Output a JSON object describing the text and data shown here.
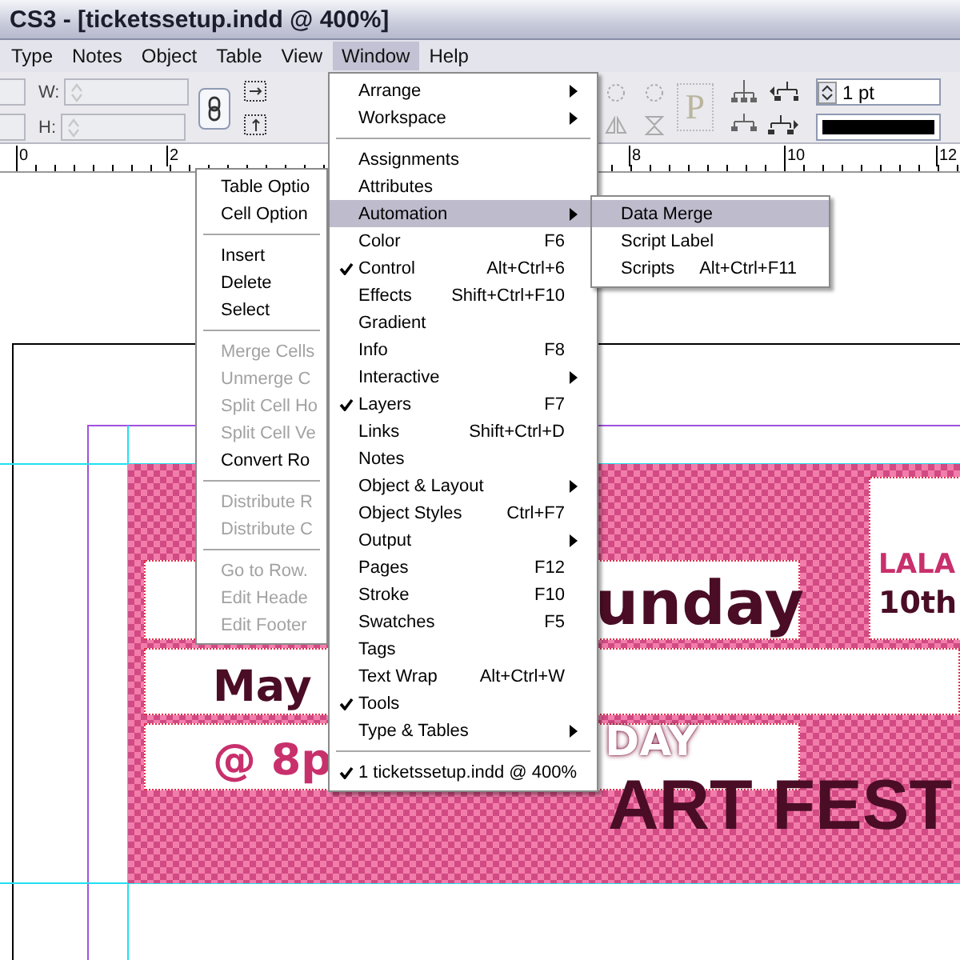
{
  "window": {
    "title": "CS3 - [ticketssetup.indd @ 400%]"
  },
  "menu_bar": [
    {
      "label": "Type",
      "selected": false
    },
    {
      "label": "Notes",
      "selected": false
    },
    {
      "label": "Object",
      "selected": false
    },
    {
      "label": "Table",
      "selected": false
    },
    {
      "label": "View",
      "selected": false
    },
    {
      "label": "Window",
      "selected": true
    },
    {
      "label": "Help",
      "selected": false
    }
  ],
  "control_panel": {
    "w_label": "W:",
    "h_label": "H:",
    "p_glyph": "P",
    "stroke_weight": "1 pt"
  },
  "ruler": {
    "labels": [
      "0",
      "2",
      "8",
      "10",
      "12"
    ]
  },
  "table_menu": {
    "items": [
      {
        "kind": "item",
        "label": "Table Optio",
        "disabled": false
      },
      {
        "kind": "item",
        "label": "Cell Option",
        "disabled": false
      },
      {
        "kind": "separator"
      },
      {
        "kind": "item",
        "label": "Insert",
        "disabled": false
      },
      {
        "kind": "item",
        "label": "Delete",
        "disabled": false
      },
      {
        "kind": "item",
        "label": "Select",
        "disabled": false
      },
      {
        "kind": "separator"
      },
      {
        "kind": "item",
        "label": "Merge Cells",
        "disabled": true
      },
      {
        "kind": "item",
        "label": "Unmerge C",
        "disabled": true
      },
      {
        "kind": "item",
        "label": "Split Cell Ho",
        "disabled": true
      },
      {
        "kind": "item",
        "label": "Split Cell Ve",
        "disabled": true
      },
      {
        "kind": "item",
        "label": "Convert Ro",
        "disabled": false
      },
      {
        "kind": "separator"
      },
      {
        "kind": "item",
        "label": "Distribute R",
        "disabled": true
      },
      {
        "kind": "item",
        "label": "Distribute C",
        "disabled": true
      },
      {
        "kind": "separator"
      },
      {
        "kind": "item",
        "label": "Go to Row.",
        "disabled": true
      },
      {
        "kind": "item",
        "label": "Edit Heade",
        "disabled": true
      },
      {
        "kind": "item",
        "label": "Edit Footer",
        "disabled": true
      }
    ]
  },
  "window_menu": {
    "items": [
      {
        "kind": "item",
        "label": "Arrange",
        "checked": false,
        "submenu": true,
        "selected": false
      },
      {
        "kind": "item",
        "label": "Workspace",
        "checked": false,
        "submenu": true,
        "selected": false
      },
      {
        "kind": "separator"
      },
      {
        "kind": "item",
        "label": "Assignments",
        "checked": false,
        "submenu": false,
        "selected": false
      },
      {
        "kind": "item",
        "label": "Attributes",
        "checked": false,
        "submenu": false,
        "selected": false
      },
      {
        "kind": "item",
        "label": "Automation",
        "checked": false,
        "submenu": true,
        "selected": true
      },
      {
        "kind": "item",
        "label": "Color",
        "shortcut": "F6",
        "checked": false,
        "submenu": false,
        "selected": false
      },
      {
        "kind": "item",
        "label": "Control",
        "shortcut": "Alt+Ctrl+6",
        "checked": true,
        "submenu": false,
        "selected": false
      },
      {
        "kind": "item",
        "label": "Effects",
        "shortcut": "Shift+Ctrl+F10",
        "checked": false,
        "submenu": false,
        "selected": false
      },
      {
        "kind": "item",
        "label": "Gradient",
        "checked": false,
        "submenu": false,
        "selected": false
      },
      {
        "kind": "item",
        "label": "Info",
        "shortcut": "F8",
        "checked": false,
        "submenu": false,
        "selected": false
      },
      {
        "kind": "item",
        "label": "Interactive",
        "checked": false,
        "submenu": true,
        "selected": false
      },
      {
        "kind": "item",
        "label": "Layers",
        "shortcut": "F7",
        "checked": true,
        "submenu": false,
        "selected": false
      },
      {
        "kind": "item",
        "label": "Links",
        "shortcut": "Shift+Ctrl+D",
        "checked": false,
        "submenu": false,
        "selected": false
      },
      {
        "kind": "item",
        "label": "Notes",
        "checked": false,
        "submenu": false,
        "selected": false
      },
      {
        "kind": "item",
        "label": "Object & Layout",
        "checked": false,
        "submenu": true,
        "selected": false
      },
      {
        "kind": "item",
        "label": "Object Styles",
        "shortcut": "Ctrl+F7",
        "checked": false,
        "submenu": false,
        "selected": false
      },
      {
        "kind": "item",
        "label": "Output",
        "checked": false,
        "submenu": true,
        "selected": false
      },
      {
        "kind": "item",
        "label": "Pages",
        "shortcut": "F12",
        "checked": false,
        "submenu": false,
        "selected": false
      },
      {
        "kind": "item",
        "label": "Stroke",
        "shortcut": "F10",
        "checked": false,
        "submenu": false,
        "selected": false
      },
      {
        "kind": "item",
        "label": "Swatches",
        "shortcut": "F5",
        "checked": false,
        "submenu": false,
        "selected": false
      },
      {
        "kind": "item",
        "label": "Tags",
        "checked": false,
        "submenu": false,
        "selected": false
      },
      {
        "kind": "item",
        "label": "Text Wrap",
        "shortcut": "Alt+Ctrl+W",
        "checked": false,
        "submenu": false,
        "selected": false
      },
      {
        "kind": "item",
        "label": "Tools",
        "checked": true,
        "submenu": false,
        "selected": false
      },
      {
        "kind": "item",
        "label": "Type & Tables",
        "checked": false,
        "submenu": true,
        "selected": false
      },
      {
        "kind": "separator"
      },
      {
        "kind": "item",
        "label": "1 ticketssetup.indd @ 400%",
        "checked": true,
        "submenu": false,
        "selected": false
      }
    ]
  },
  "automation_submenu": {
    "items": [
      {
        "kind": "item",
        "label": "Data Merge",
        "checked": false,
        "submenu": false,
        "selected": true
      },
      {
        "kind": "item",
        "label": "Script Label",
        "checked": false,
        "submenu": false,
        "selected": false
      },
      {
        "kind": "item",
        "label": "Scripts",
        "shortcut": "Alt+Ctrl+F11",
        "checked": false,
        "submenu": false,
        "selected": false
      }
    ]
  },
  "ticket": {
    "texts": [
      {
        "text": "unday"
      },
      {
        "text": "LALA"
      },
      {
        "text": "10th"
      },
      {
        "text": "May"
      },
      {
        "text": "@ 8p"
      },
      {
        "text": "DAY"
      },
      {
        "text": "ART FEST"
      }
    ]
  }
}
